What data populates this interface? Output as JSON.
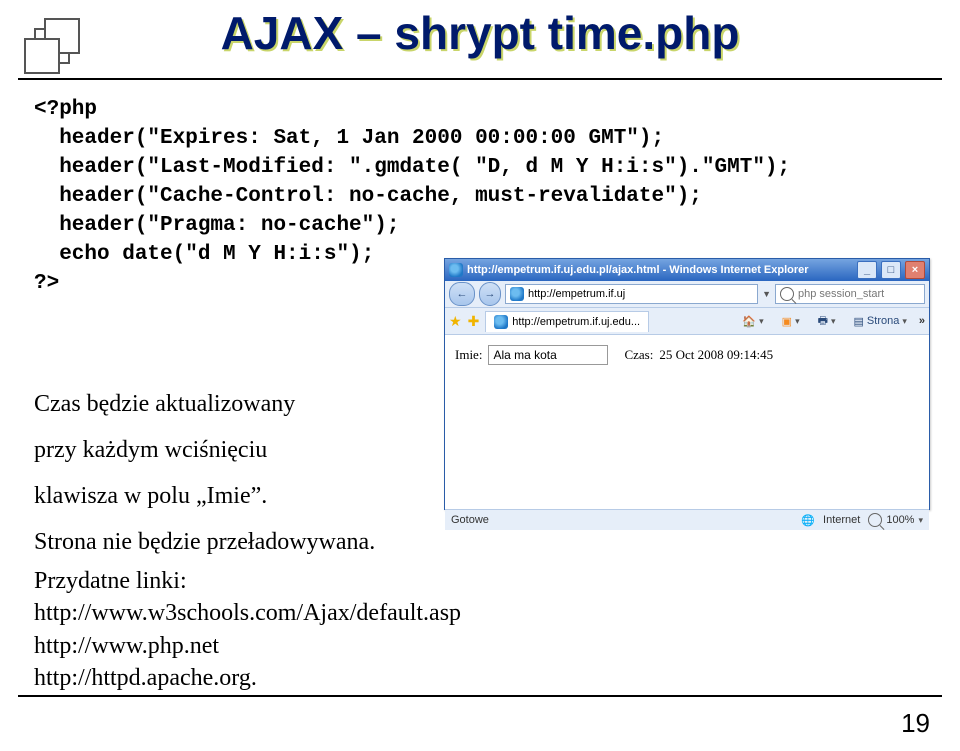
{
  "slide": {
    "title": "AJAX – shrypt time.php",
    "page_number": "19"
  },
  "code": "<?php\n  header(\"Expires: Sat, 1 Jan 2000 00:00:00 GMT\");\n  header(\"Last-Modified: \".gmdate( \"D, d M Y H:i:s\").\"GMT\");\n  header(\"Cache-Control: no-cache, must-revalidate\");\n  header(\"Pragma: no-cache\");\n  echo date(\"d M Y H:i:s\");\n?>",
  "body": {
    "line1": "Czas będzie aktualizowany",
    "line2": "przy każdym wciśnięciu",
    "line3": "klawisza w polu „Imie”.",
    "line4": "Strona nie będzie przeładowywana."
  },
  "links": {
    "heading": "Przydatne linki:",
    "l1": "http://www.w3schools.com/Ajax/default.asp",
    "l2": "http://www.php.net",
    "l3": "http://httpd.apache.org."
  },
  "browser": {
    "title": "http://empetrum.if.uj.edu.pl/ajax.html - Windows Internet Explorer",
    "address": "http://empetrum.if.uj",
    "search_placeholder": "php session_start",
    "tab_label": "http://empetrum.if.uj.edu...",
    "tool_home": "",
    "tool_strona": "Strona",
    "back": "←",
    "fwd": "→",
    "min": "_",
    "max": "□",
    "close": "×",
    "chevrons": "»",
    "form": {
      "imie_label": "Imie:",
      "imie_value": "Ala ma kota",
      "czas_label": "Czas:",
      "czas_value": "25 Oct 2008 09:14:45"
    },
    "status": {
      "text": "Gotowe",
      "zone": "Internet",
      "zoom": "100%"
    }
  }
}
